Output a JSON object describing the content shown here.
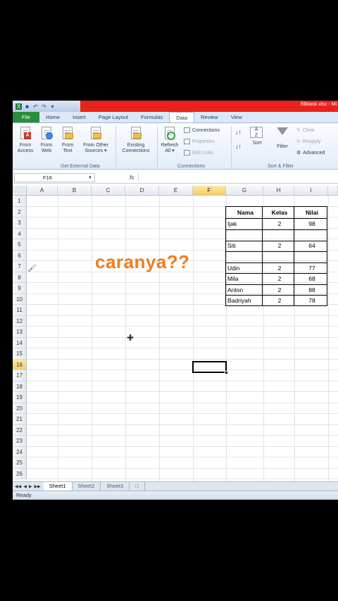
{
  "window": {
    "title": "fillblank.xlsx - Mi"
  },
  "ribbon_tabs": [
    "File",
    "Home",
    "Insert",
    "Page Layout",
    "Formulas",
    "Data",
    "Review",
    "View"
  ],
  "ribbon": {
    "get_external": {
      "from_access": [
        "From",
        "Access"
      ],
      "from_web": [
        "From",
        "Web"
      ],
      "from_text": [
        "From",
        "Text"
      ],
      "from_other": [
        "From Other",
        "Sources ▾"
      ],
      "existing": [
        "Existing",
        "Connections"
      ],
      "label": "Get External Data"
    },
    "connections": {
      "refresh": [
        "Refresh",
        "All ▾"
      ],
      "connections": "Connections",
      "properties": "Properties",
      "edit_links": "Edit Links",
      "label": "Connections"
    },
    "sort_filter": {
      "sort": "Sort",
      "filter": "Filter",
      "clear": "Clear",
      "reapply": "Reapply",
      "advanced": "Advanced",
      "label": "Sort & Filter"
    }
  },
  "formula_bar": {
    "name_box": "F16",
    "fx": "fx"
  },
  "columns": [
    "A",
    "B",
    "C",
    "D",
    "E",
    "F",
    "G",
    "H",
    "I"
  ],
  "rows": [
    "1",
    "2",
    "3",
    "4",
    "5",
    "6",
    "7",
    "8",
    "9",
    "10",
    "11",
    "12",
    "13",
    "14",
    "15",
    "16",
    "17",
    "18",
    "19",
    "20",
    "21",
    "22",
    "23",
    "24",
    "25",
    "26"
  ],
  "selected": {
    "column": "F",
    "row": "16"
  },
  "table": {
    "headers": [
      "Nama",
      "Kelas",
      "Nilai"
    ],
    "rows": [
      {
        "row": "3",
        "nama": "Ijak",
        "kelas": "2",
        "nilai": "98"
      },
      {
        "row": "4",
        "nama": "",
        "kelas": "",
        "nilai": ""
      },
      {
        "row": "5",
        "nama": "Siti",
        "kelas": "2",
        "nilai": "64"
      },
      {
        "row": "6",
        "nama": "",
        "kelas": "",
        "nilai": ""
      },
      {
        "row": "7",
        "nama": "Udin",
        "kelas": "2",
        "nilai": "77"
      },
      {
        "row": "8",
        "nama": "Mila",
        "kelas": "2",
        "nilai": "68"
      },
      {
        "row": "9",
        "nama": "Anton",
        "kelas": "2",
        "nilai": "88"
      },
      {
        "row": "10",
        "nama": "Badriyah",
        "kelas": "2",
        "nilai": "78"
      }
    ]
  },
  "overlay_caption": "caranya??",
  "sheets": [
    "Sheet1",
    "Sheet2",
    "Sheet3"
  ],
  "active_sheet": "Sheet1",
  "status": "Ready",
  "colors": {
    "title_red": "#e8231c",
    "file_tab_green": "#2a8d3a",
    "caption_orange": "#f07c1e",
    "selected_header": "#f6cf62"
  }
}
